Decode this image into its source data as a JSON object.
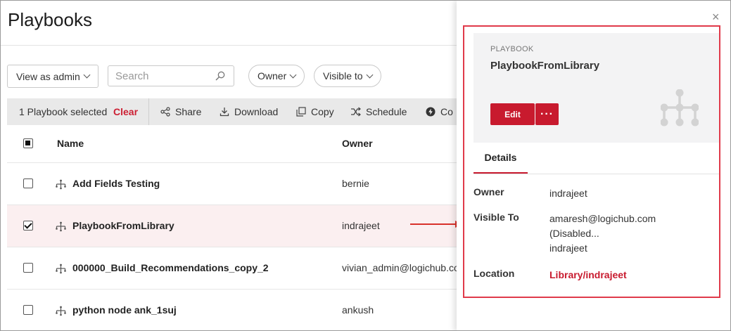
{
  "page": {
    "title": "Playbooks"
  },
  "filters": {
    "view_as": "View as admin",
    "search_placeholder": "Search",
    "owner": "Owner",
    "visible_to": "Visible to"
  },
  "toolbar": {
    "selected_text": "1 Playbook selected",
    "clear": "Clear",
    "actions": [
      {
        "label": "Share",
        "icon": "share-icon"
      },
      {
        "label": "Download",
        "icon": "download-icon"
      },
      {
        "label": "Copy",
        "icon": "copy-icon"
      },
      {
        "label": "Schedule",
        "icon": "shuffle-icon"
      },
      {
        "label": "Co",
        "icon": "lightning-icon"
      }
    ]
  },
  "table": {
    "columns": [
      "Name",
      "Owner"
    ],
    "rows": [
      {
        "name": "Add Fields Testing",
        "owner": "bernie",
        "checked": false
      },
      {
        "name": "PlaybookFromLibrary",
        "owner": "indrajeet",
        "checked": true
      },
      {
        "name": "000000_Build_Recommendations_copy_2",
        "owner": "vivian_admin@logichub.com",
        "checked": false
      },
      {
        "name": "python node ank_1suj",
        "owner": "ankush",
        "checked": false
      }
    ]
  },
  "panel": {
    "close": "×",
    "kind": "PLAYBOOK",
    "name": "PlaybookFromLibrary",
    "edit": "Edit",
    "more": "···",
    "tab": "Details",
    "details": {
      "owner_label": "Owner",
      "owner_value": "indrajeet",
      "visible_label": "Visible To",
      "visible_values": [
        "amaresh@logichub.com",
        "(Disabled...",
        "indrajeet"
      ],
      "location_label": "Location",
      "location_value": "Library/indrajeet"
    }
  },
  "colors": {
    "accent": "#c81a2e",
    "highlight": "#e03a4a",
    "selected_row": "#fbeff0"
  }
}
